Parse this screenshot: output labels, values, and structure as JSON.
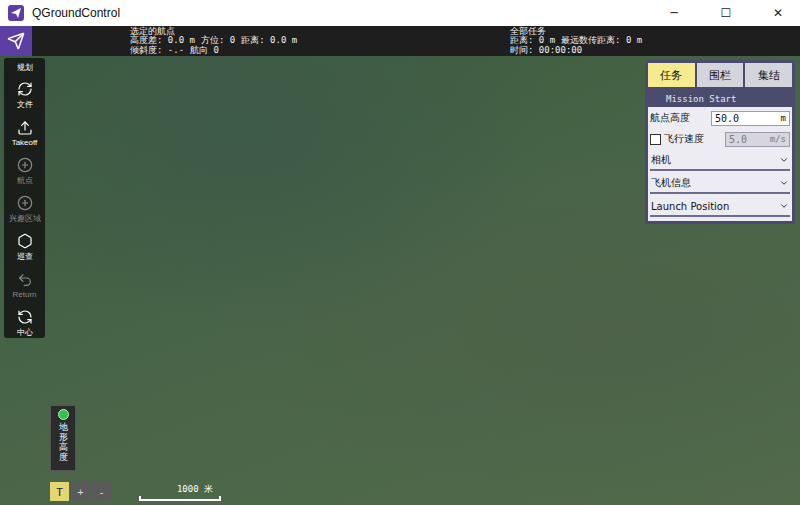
{
  "window": {
    "title": "QGroundControl",
    "controls": [
      "─",
      "☐",
      "✕"
    ]
  },
  "status": {
    "waypoint_title": "选定的航点",
    "altitude_diff_label": "高度差:",
    "altitude_diff": "0.0 m",
    "azimuth_label": "方位:",
    "azimuth": "0",
    "distance_label": "距离:",
    "distance": "0.0 m",
    "slope_label": "倾斜度:",
    "slope": "-.-",
    "heading_label": "航向",
    "heading": "0"
  },
  "mission_totals": {
    "title": "全部任务",
    "distance_label": "距离:",
    "distance": "0 m",
    "max_telemetry_label": "最远数传距离:",
    "max_telemetry": "0 m",
    "time_label": "时间:",
    "time": "00:00:00"
  },
  "toolbar": {
    "title": "规划",
    "items": [
      {
        "label": "文件",
        "disabled": false
      },
      {
        "label": "Takeoff",
        "disabled": false
      },
      {
        "label": "航点",
        "disabled": true
      },
      {
        "label": "兴趣区域",
        "disabled": true
      },
      {
        "label": "巡查",
        "disabled": false
      },
      {
        "label": "Return",
        "disabled": true
      },
      {
        "label": "中心",
        "disabled": false
      }
    ]
  },
  "plan_panel": {
    "tabs": [
      {
        "label": "任务",
        "selected": true
      },
      {
        "label": "围栏",
        "selected": false
      },
      {
        "label": "集结",
        "selected": false
      }
    ],
    "header": "Mission Start",
    "rows": [
      {
        "kind": "field",
        "label": "航点高度",
        "value": "50.0",
        "unit": "m",
        "checked": false,
        "disabled": false
      },
      {
        "kind": "checkfield",
        "label": "飞行速度",
        "value": "5.0",
        "unit": "m/s",
        "checked": false,
        "disabled": true
      },
      {
        "kind": "section",
        "label": "相机",
        "expanded": false
      },
      {
        "kind": "section",
        "label": "飞机信息",
        "expanded": false
      },
      {
        "kind": "section",
        "label": "Launch Position",
        "expanded": false
      }
    ]
  },
  "map": {
    "terrain": {
      "label": "地形高度"
    },
    "zoom_buttons": [
      {
        "label": "T",
        "selected": true
      },
      {
        "label": "+",
        "selected": false
      },
      {
        "label": "-",
        "selected": false
      }
    ],
    "scale": "1000 米"
  }
}
